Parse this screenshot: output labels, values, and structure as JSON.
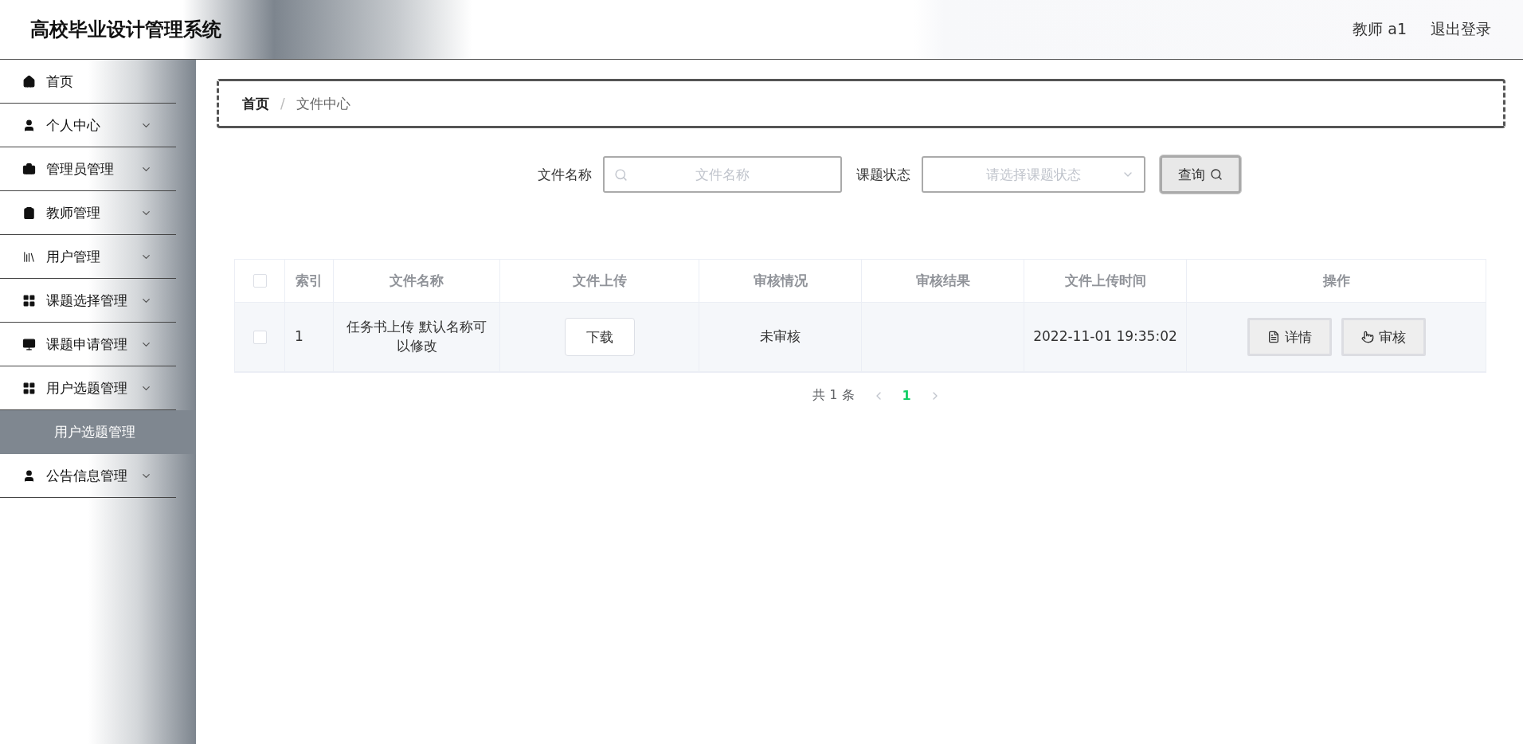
{
  "header": {
    "title": "高校毕业设计管理系统",
    "user": "教师 a1",
    "logout": "退出登录"
  },
  "sidebar": {
    "items": [
      {
        "label": "首页",
        "kind": "link"
      },
      {
        "label": "个人中心",
        "kind": "menu"
      },
      {
        "label": "管理员管理",
        "kind": "menu"
      },
      {
        "label": "教师管理",
        "kind": "menu"
      },
      {
        "label": "用户管理",
        "kind": "menu"
      },
      {
        "label": "课题选择管理",
        "kind": "menu"
      },
      {
        "label": "课题申请管理",
        "kind": "menu"
      },
      {
        "label": "用户选题管理",
        "kind": "menu",
        "children": [
          {
            "label": "用户选题管理",
            "selected": true
          }
        ]
      },
      {
        "label": "公告信息管理",
        "kind": "menu"
      }
    ]
  },
  "breadcrumb": {
    "items": [
      "首页",
      "文件中心"
    ],
    "separator": "/"
  },
  "search": {
    "fields": [
      {
        "label": "文件名称",
        "kind": "input",
        "placeholder": "文件名称"
      },
      {
        "label": "课题状态",
        "kind": "select",
        "placeholder": "请选择课题状态"
      }
    ],
    "button": "查询"
  },
  "table": {
    "header_checked": false,
    "columns": [
      "索引",
      "文件名称",
      "文件上传",
      "审核情况",
      "审核结果",
      "文件上传时间",
      "操作"
    ],
    "rows": [
      {
        "checked": false,
        "index": "1",
        "name": "任务书上传 默认名称可以修改",
        "upload": "下载",
        "review_status": "未审核",
        "review_result": "",
        "time": "2022-11-01 19:35:02",
        "actions": [
          "详情",
          "审核"
        ]
      }
    ]
  },
  "pagination": {
    "total": "共 1 条",
    "pages": [
      {
        "label": "1",
        "selected": true
      }
    ]
  }
}
